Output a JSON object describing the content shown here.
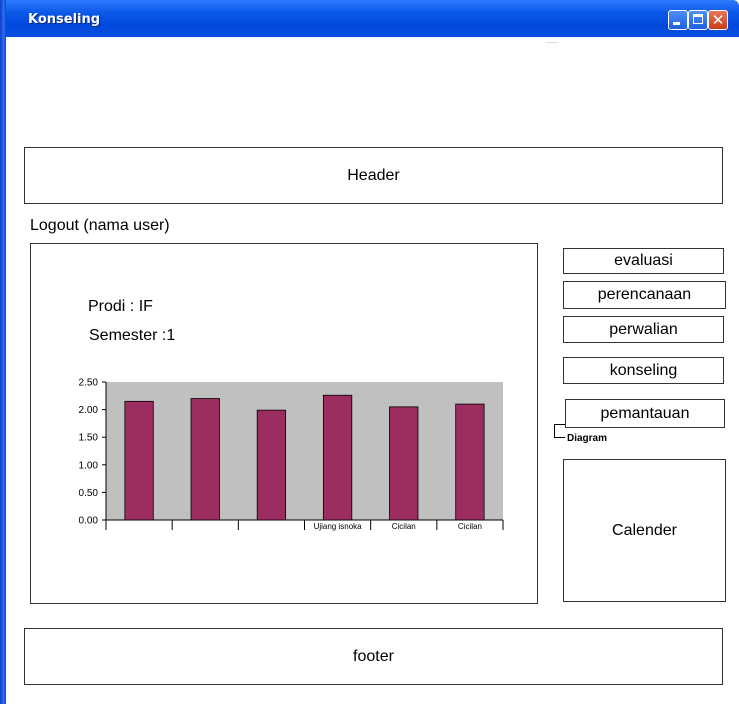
{
  "window": {
    "title": "Konseling"
  },
  "header": {
    "label": "Header"
  },
  "logout": {
    "label": "Logout (nama user)"
  },
  "info": {
    "prodi": "Prodi : IF",
    "semester": "Semester :1"
  },
  "nav": {
    "items": [
      {
        "label": "evaluasi"
      },
      {
        "label": "perencanaan"
      },
      {
        "label": "perwalian"
      },
      {
        "label": "konseling"
      },
      {
        "label": "pemantauan"
      }
    ]
  },
  "diagram": {
    "label": "Diagram"
  },
  "calendar": {
    "label": "Calender"
  },
  "footer": {
    "label": "footer"
  },
  "chart_data": {
    "type": "bar",
    "categories": [
      "",
      "",
      "",
      "Ujiang isnoka",
      "Cicilan",
      "Cicilan"
    ],
    "values": [
      2.15,
      2.2,
      1.99,
      2.26,
      2.05,
      2.1
    ],
    "ylim": [
      0,
      2.5
    ],
    "yticks": [
      "0.00",
      "0.50",
      "1.00",
      "1.50",
      "2.00",
      "2.50"
    ],
    "bar_color": "#9c2d60",
    "plot_bg": "#c0c0c0",
    "grid": false
  }
}
